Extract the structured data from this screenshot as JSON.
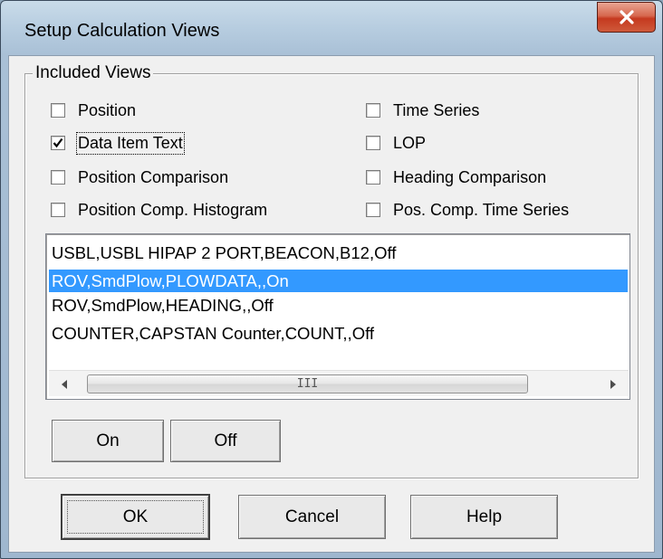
{
  "window": {
    "title": "Setup Calculation Views",
    "close_label": "close"
  },
  "group": {
    "label": "Included Views"
  },
  "checkboxes": [
    {
      "label": "Position",
      "checked": false
    },
    {
      "label": "Time Series",
      "checked": false
    },
    {
      "label": "Data Item Text",
      "checked": true
    },
    {
      "label": "LOP",
      "checked": false
    },
    {
      "label": "Position Comparison",
      "checked": false
    },
    {
      "label": "Heading Comparison",
      "checked": false
    },
    {
      "label": "Position Comp. Histogram",
      "checked": false
    },
    {
      "label": "Pos. Comp. Time Series",
      "checked": false
    }
  ],
  "list": {
    "items": [
      {
        "text": "USBL,USBL HIPAP 2 PORT,BEACON,B12,Off",
        "selected": false
      },
      {
        "text": "ROV,SmdPlow,PLOWDATA,,On",
        "selected": true
      },
      {
        "text": "ROV,SmdPlow,HEADING,,Off",
        "selected": false
      },
      {
        "text": "COUNTER,CAPSTAN Counter,COUNT,,Off",
        "selected": false
      }
    ]
  },
  "scrollbar": {
    "grip": "III",
    "left_arrow_icon": "triangle-left",
    "right_arrow_icon": "triangle-right"
  },
  "buttons": {
    "on": "On",
    "off": "Off",
    "ok": "OK",
    "cancel": "Cancel",
    "help": "Help"
  },
  "colors": {
    "selection": "#3399ff",
    "close_button": "#c5391f",
    "dialog_bg": "#f0f0f0"
  }
}
